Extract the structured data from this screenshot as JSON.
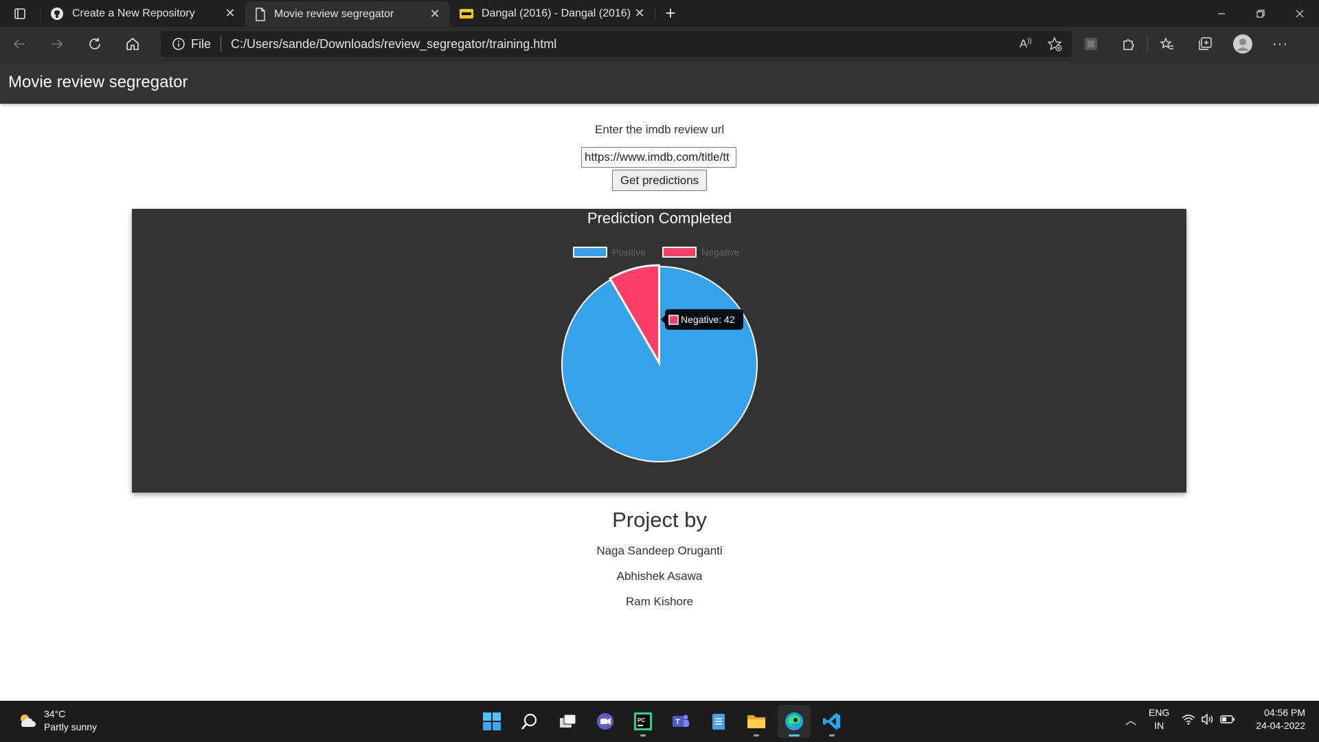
{
  "browser": {
    "tabs": [
      {
        "title": "Create a New Repository",
        "icon": "github-icon",
        "active": false
      },
      {
        "title": "Movie review segregator",
        "icon": "file-icon",
        "active": true
      },
      {
        "title": "Dangal (2016) - Dangal (2016) - ",
        "icon": "imdb-icon",
        "active": false
      }
    ],
    "address": {
      "scheme_label": "File",
      "url": "C:/Users/sande/Downloads/review_segregator/training.html"
    }
  },
  "app": {
    "title": "Movie review segregator",
    "form": {
      "label": "Enter the imdb review url",
      "url_value": "https://www.imdb.com/title/tt",
      "submit_label": "Get predictions"
    },
    "footer": {
      "heading": "Project by",
      "members": [
        "Naga Sandeep Oruganti",
        "Abhishek Asawa",
        "Ram Kishore"
      ]
    }
  },
  "chart_data": {
    "type": "pie",
    "title": "Prediction Completed",
    "categories": [
      "Positive",
      "Negative"
    ],
    "values": [
      458,
      42
    ],
    "colors": [
      "#36a2eb",
      "#ff3d67"
    ],
    "legend_position": "top",
    "tooltip": {
      "label": "Negative: 42",
      "category": "Negative"
    }
  },
  "taskbar": {
    "weather": {
      "temp": "34°C",
      "condition": "Partly sunny"
    },
    "language": {
      "lang": "ENG",
      "region": "IN"
    },
    "clock": {
      "time": "04:56 PM",
      "date": "24-04-2022"
    }
  }
}
